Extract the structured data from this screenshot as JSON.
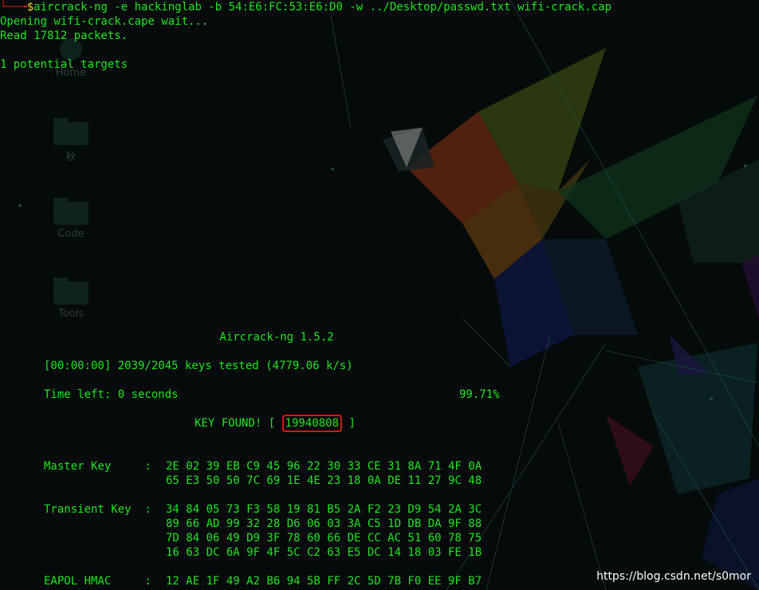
{
  "desktop_icons": [
    {
      "label": "Home",
      "icon": "home-icon"
    },
    {
      "label": "秋",
      "icon": "folder-icon"
    },
    {
      "label": "Code",
      "icon": "folder-icon"
    },
    {
      "label": "Tools",
      "icon": "folder-icon"
    }
  ],
  "terminal": {
    "prompt_arrow": "└──╼",
    "prompt_symbol": "$",
    "command": "aircrack-ng -e hackinglab -b 54:E6:FC:53:E6:D0 -w ../Desktop/passwd.txt wifi-crack.cap",
    "opening": "Opening wifi-crack.cape wait...",
    "read": "Read 17812 packets.",
    "targets": "1 potential targets",
    "version": "Aircrack-ng 1.5.2",
    "progress": "[00:00:00] 2039/2045 keys tested (4779.06 k/s)",
    "time_left": "Time left: 0 seconds",
    "percent": "99.71%",
    "key_found_prefix": "KEY FOUND! [ ",
    "key": "19940808",
    "key_found_suffix": " ]",
    "master_key_label": "Master Key     : ",
    "master_key_lines": [
      "2E 02 39 EB C9 45 96 22 30 33 CE 31 8A 71 4F 0A",
      "65 E3 50 50 7C 69 1E 4E 23 18 0A DE 11 27 9C 48"
    ],
    "transient_key_label": "Transient Key  : ",
    "transient_key_lines": [
      "34 84 05 73 F3 58 19 81 B5 2A F2 23 D9 54 2A 3C",
      "89 66 AD 99 32 28 D6 06 03 3A C5 1D DB DA 9F 88",
      "7D 84 06 49 D9 3F 78 60 66 DE CC AC 51 60 78 75",
      "16 63 DC 6A 9F 4F 5C C2 63 E5 DC 14 18 03 FE 1B"
    ],
    "eapol_label": "EAPOL HMAC     : ",
    "eapol_line": "12 AE 1F 49 A2 B6 94 5B FF 2C 5D 7B F0 EE 9F B7"
  },
  "watermark": "https://blog.csdn.net/s0mor",
  "colors": {
    "terminal_text": "#1ee61e",
    "highlight_box": "#e01010",
    "prompt_symbol": "#ffd52b",
    "prompt_arrow": "#d11414"
  }
}
